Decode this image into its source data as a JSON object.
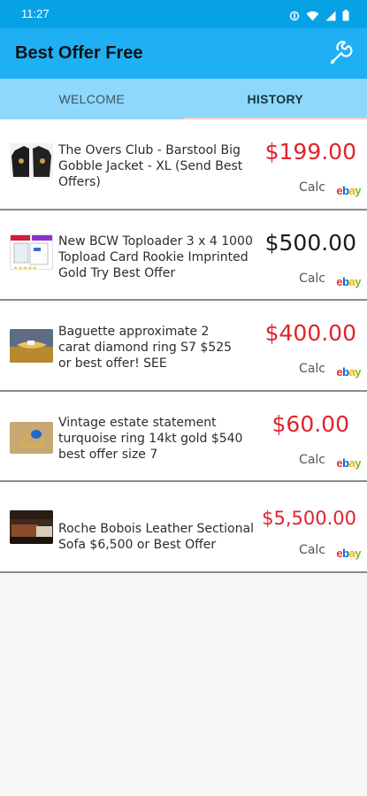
{
  "status_bar": {
    "time": "11:27"
  },
  "app_bar": {
    "title": "Best Offer Free",
    "settings_icon": "wrench-icon"
  },
  "tabs": [
    {
      "label": "WELCOME",
      "active": false
    },
    {
      "label": "HISTORY",
      "active": true
    }
  ],
  "colors": {
    "status_bar": "#07a2e6",
    "app_bar": "#1fb0f4",
    "tabs": "#8ed8fb",
    "price_red": "#e1232b",
    "price_black": "#1a1a1a"
  },
  "items": [
    {
      "title": "The Overs Club - Barstool Big Gobble Jacket - XL (Send Best Offers)",
      "price": "$199.00",
      "price_color": "red",
      "calc": "Calc",
      "marketplace": "ebay",
      "thumb": "jacket"
    },
    {
      "title": "New BCW Toploader 3 x 4 1000 Topload Card Rookie Imprinted Gold Try Best Offer",
      "price": "$500.00",
      "price_color": "black",
      "calc": "Calc",
      "marketplace": "ebay",
      "thumb": "toploader"
    },
    {
      "title": "Baguette approximate 2 carat diamond ring S7 $525 or best offer! SEE",
      "price": "$400.00",
      "price_color": "red",
      "calc": "Calc",
      "marketplace": "ebay",
      "thumb": "diamond-ring"
    },
    {
      "title": "Vintage estate statement turquoise ring 14kt gold $540 best offer size 7",
      "price": "$60.00",
      "price_color": "red",
      "calc": "Calc",
      "marketplace": "ebay",
      "thumb": "turquoise-ring"
    },
    {
      "title": "Roche Bobois Leather Sectional Sofa $6,500 or Best Offer",
      "price": "$5,500.00",
      "price_color": "red",
      "calc": "Calc",
      "marketplace": "ebay",
      "thumb": "sofa"
    }
  ]
}
